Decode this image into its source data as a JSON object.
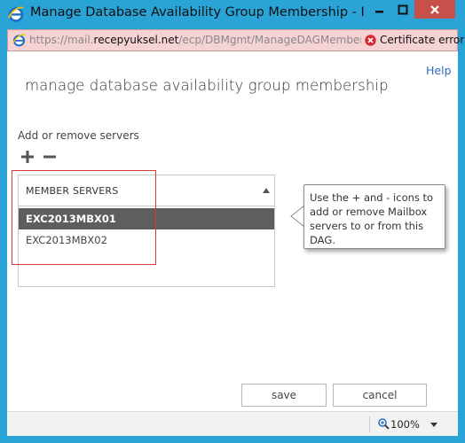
{
  "window": {
    "title": "Manage Database Availability Group Membership - Inter...",
    "icon": "ie-icon",
    "controls": [
      "minimize-icon",
      "maximize-icon",
      "close-icon"
    ],
    "accent_color": "#2aa3d6",
    "close_color": "#c7514a"
  },
  "address_bar": {
    "url_prefix": "https://mail.",
    "url_host": "recepyuksel.net",
    "url_path": "/ecp/DBMgmt/ManageDAGMembership.",
    "certificate_label": "Certificate error",
    "background_color": "#f5d2d4"
  },
  "dialog": {
    "help_label": "Help",
    "title": "manage database availability group membership",
    "section_label": "Add or remove servers",
    "add_icon": "plus-icon",
    "remove_icon": "minus-icon",
    "list": {
      "column_header": "MEMBER SERVERS",
      "rows": [
        {
          "name": "EXC2013MBX01",
          "selected": true
        },
        {
          "name": "EXC2013MBX02",
          "selected": false
        }
      ]
    },
    "callout_text": "Use the + and - icons to add or remove Mailbox servers to or from this DAG.",
    "save_label": "save",
    "cancel_label": "cancel"
  },
  "status_bar": {
    "zoom_label": "100%"
  }
}
